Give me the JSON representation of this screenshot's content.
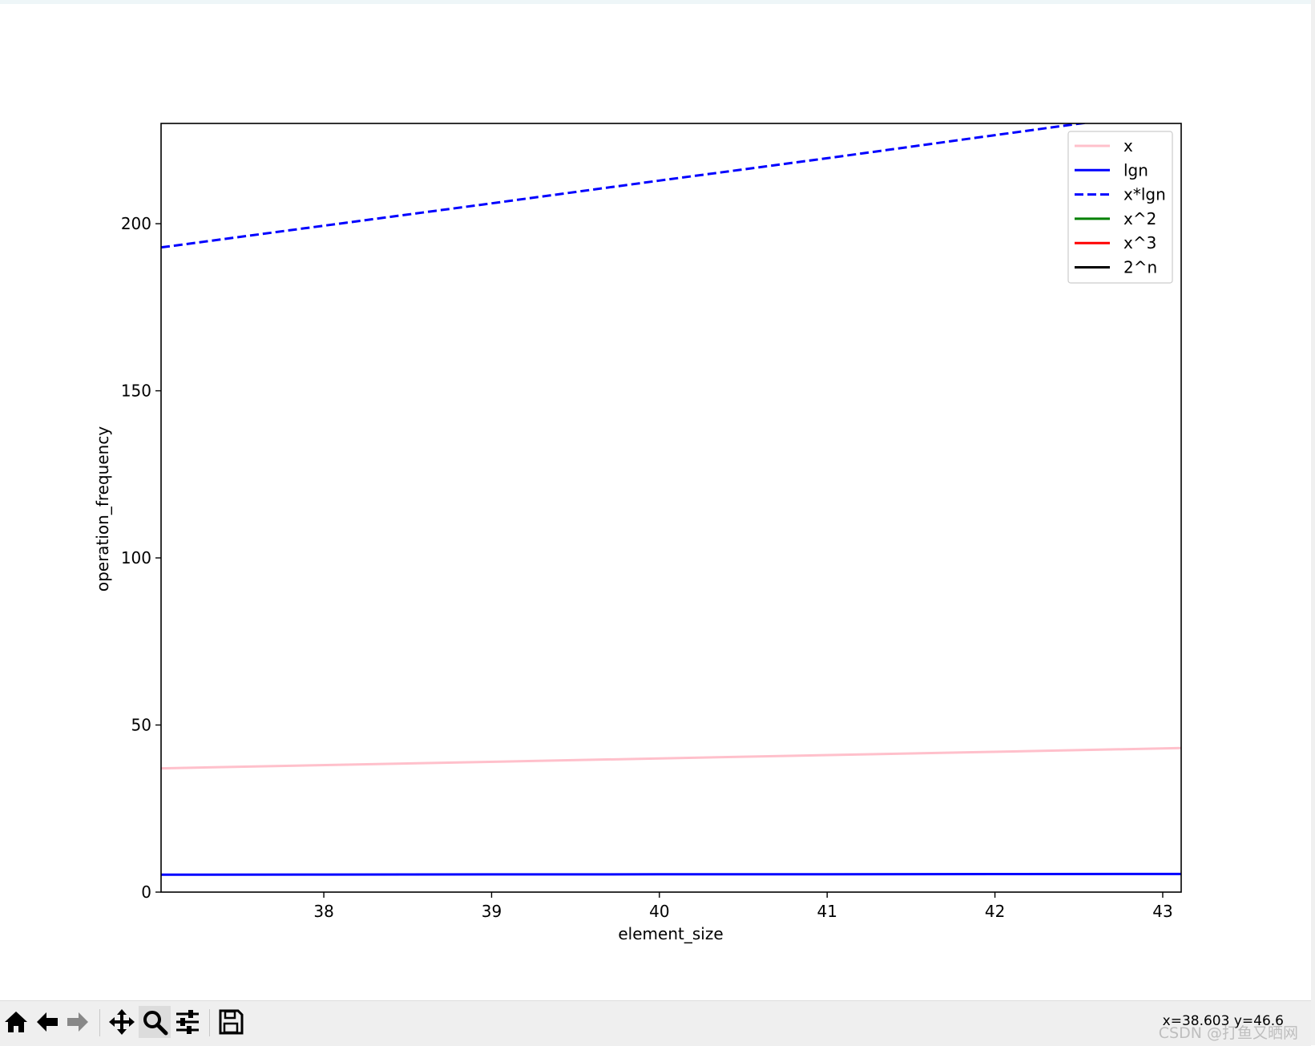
{
  "chart_data": {
    "type": "line",
    "xlabel": "element_size",
    "ylabel": "operation_frequency",
    "xlim": [
      37.03,
      43.11
    ],
    "ylim": [
      0,
      230
    ],
    "xticks": [
      38,
      39,
      40,
      41,
      42,
      43
    ],
    "yticks": [
      0,
      50,
      100,
      150,
      200
    ],
    "grid": false,
    "legend_position": "top-right",
    "series": [
      {
        "name": "x",
        "color": "#ffc0cb",
        "style": "solid",
        "x": [
          37.03,
          43.11
        ],
        "y": [
          37.03,
          43.11
        ]
      },
      {
        "name": "lgn",
        "color": "#0000ff",
        "style": "solid",
        "x": [
          37.03,
          38,
          39,
          40,
          41,
          42,
          43.11
        ],
        "y": [
          5.21,
          5.25,
          5.29,
          5.32,
          5.36,
          5.39,
          5.43
        ]
      },
      {
        "name": "x*lgn",
        "color": "#0000ff",
        "style": "dashed",
        "x": [
          37.03,
          38,
          39,
          40,
          41,
          42,
          43.11
        ],
        "y": [
          192.9,
          199.4,
          206.1,
          212.9,
          219.6,
          226.5,
          234.1
        ]
      },
      {
        "name": "x^2",
        "color": "#008000",
        "style": "solid",
        "x": [],
        "y": []
      },
      {
        "name": "x^3",
        "color": "#ff0000",
        "style": "solid",
        "x": [],
        "y": []
      },
      {
        "name": "2^n",
        "color": "#000000",
        "style": "solid",
        "x": [],
        "y": []
      }
    ]
  },
  "toolbar": {
    "buttons": [
      {
        "name": "home-button",
        "icon": "home-icon"
      },
      {
        "name": "back-button",
        "icon": "arrow-left-icon"
      },
      {
        "name": "forward-button",
        "icon": "arrow-right-icon"
      },
      {
        "name": "pan-button",
        "icon": "move-icon"
      },
      {
        "name": "zoom-button",
        "icon": "magnifier-icon",
        "active": true
      },
      {
        "name": "configure-subplots-button",
        "icon": "sliders-icon"
      },
      {
        "name": "save-button",
        "icon": "floppy-disk-icon"
      }
    ],
    "coords": "x=38.603 y=46.6"
  },
  "watermark": "CSDN @打鱼又晒网"
}
